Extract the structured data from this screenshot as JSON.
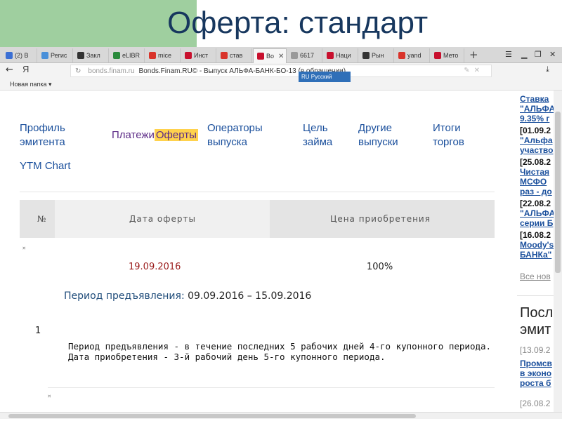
{
  "slide": {
    "title": "Оферта: стандарт"
  },
  "tabs": [
    {
      "label": "(2) В",
      "icon": "mail-icon",
      "color": "#3b6fd4"
    },
    {
      "label": "Регис",
      "icon": "map-icon",
      "color": "#4a90d9"
    },
    {
      "label": "Закл",
      "icon": "star-icon",
      "color": "#333333"
    },
    {
      "label": "eLIBR",
      "icon": "elibrary-icon",
      "color": "#2a8a3c"
    },
    {
      "label": "mice",
      "icon": "yandex-icon",
      "color": "#d9342b"
    },
    {
      "label": "Инст",
      "icon": "alfa-icon",
      "color": "#c8102e"
    },
    {
      "label": "став",
      "icon": "yandex-icon",
      "color": "#d9342b"
    },
    {
      "label": "Во",
      "icon": "chart-icon",
      "color": "#c8102e"
    },
    {
      "label": "6617",
      "icon": "page-icon",
      "color": "#999999"
    },
    {
      "label": "Наци",
      "icon": "alfa-icon",
      "color": "#c8102e"
    },
    {
      "label": "Рын",
      "icon": "wikipedia-icon",
      "color": "#333333"
    },
    {
      "label": "yand",
      "icon": "yandex-icon",
      "color": "#d9342b"
    },
    {
      "label": "Мето",
      "icon": "alfa-icon",
      "color": "#c8102e"
    }
  ],
  "window": {
    "new_tab": "+",
    "menu": "☰",
    "minimize": "▁",
    "restore": "❐",
    "close": "✕"
  },
  "address": {
    "back": "←",
    "logo": "Я",
    "reload": "↻",
    "host": "bonds.finam.ru",
    "title": "Bonds.Finam.RU© - Выпуск АЛЬФА-БАНК-БО-13 (в обращении)",
    "lang": "RU Русский",
    "download": "⤓"
  },
  "bookmarks": {
    "folder": "Новая папка ▾"
  },
  "nav": {
    "issuer_l1": "Профиль",
    "issuer_l2": "эмитента",
    "payments": "Платежи",
    "offers": "Оферты",
    "operators_l1": "Операторы",
    "operators_l2": "выпуска",
    "purpose_l1": "Цель",
    "purpose_l2": "займа",
    "other_l1": "Другие",
    "other_l2": "выпуски",
    "results_l1": "Итоги",
    "results_l2": "торгов",
    "ytm": "YTM Chart"
  },
  "table": {
    "headers": [
      "№",
      "Дата оферты",
      "Цена приобретения"
    ],
    "row": {
      "num": "1",
      "date": "19.09.2016",
      "price": "100%"
    },
    "period_label": "Период предъявления:",
    "period_value": "09.09.2016 – 15.09.2016",
    "note": "Период предъявления - в течение последних 5 рабочих дней 4-го купонного периода. Дата приобретения - 3-й рабочий день 5-го купонного периода."
  },
  "sidebar": {
    "items": [
      {
        "text": "Ставка",
        "kind": "link"
      },
      {
        "text": "\"АЛЬФА",
        "kind": "link"
      },
      {
        "text": "9.35% г",
        "kind": "link"
      },
      {
        "text": "[01.09.2",
        "kind": "date"
      },
      {
        "text": "\"Альфа",
        "kind": "link"
      },
      {
        "text": "участво",
        "kind": "link"
      },
      {
        "text": "[25.08.2",
        "kind": "date"
      },
      {
        "text": "Чистая",
        "kind": "link"
      },
      {
        "text": "МСФО",
        "kind": "link"
      },
      {
        "text": "раз - до",
        "kind": "link"
      },
      {
        "text": "[22.08.2",
        "kind": "date"
      },
      {
        "text": "\"АЛЬФА",
        "kind": "link"
      },
      {
        "text": "серии Б",
        "kind": "link"
      },
      {
        "text": "[16.08.2",
        "kind": "date"
      },
      {
        "text": "Moody's",
        "kind": "link"
      },
      {
        "text": "БАНКа\"",
        "kind": "link"
      }
    ],
    "all_news": "Все нов",
    "section_l1": "Посл",
    "section_l2": "эмит",
    "items2": [
      {
        "text": "[13.09.2",
        "kind": "gray"
      },
      {
        "text": "Промсв",
        "kind": "link"
      },
      {
        "text": "в эконо",
        "kind": "link"
      },
      {
        "text": "роста б",
        "kind": "link"
      },
      {
        "text": "[26.08.2",
        "kind": "gray"
      }
    ]
  }
}
